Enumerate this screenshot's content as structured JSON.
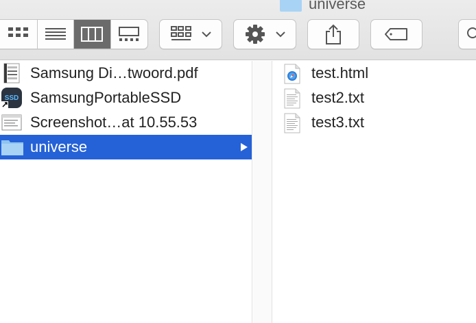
{
  "window": {
    "title": "universe"
  },
  "toolbar": {
    "view_modes": [
      "icon-view",
      "list-view",
      "column-view",
      "gallery-view"
    ],
    "active_view": "column-view",
    "buttons": [
      "arrange-button",
      "action-button",
      "share-button",
      "tags-button",
      "search-button"
    ]
  },
  "column1": {
    "items": [
      {
        "label": "Samsung Di…twoord.pdf",
        "icon": "pdf-file-icon"
      },
      {
        "label": "SamsungPortableSSD",
        "icon": "ssd-app-alias-icon",
        "badge": "SSD"
      },
      {
        "label": "Screenshot…at 10.55.53",
        "icon": "screenshot-file-icon"
      },
      {
        "label": "universe",
        "icon": "folder-icon",
        "selected": true
      }
    ]
  },
  "column2": {
    "items": [
      {
        "label": "test.html",
        "icon": "html-file-icon"
      },
      {
        "label": "test2.txt",
        "icon": "text-file-icon"
      },
      {
        "label": "test3.txt",
        "icon": "text-file-icon"
      }
    ]
  },
  "colors": {
    "selection": "#2562d8",
    "folder": "#a9d3f5",
    "active_segment": "#6b6b6b"
  }
}
